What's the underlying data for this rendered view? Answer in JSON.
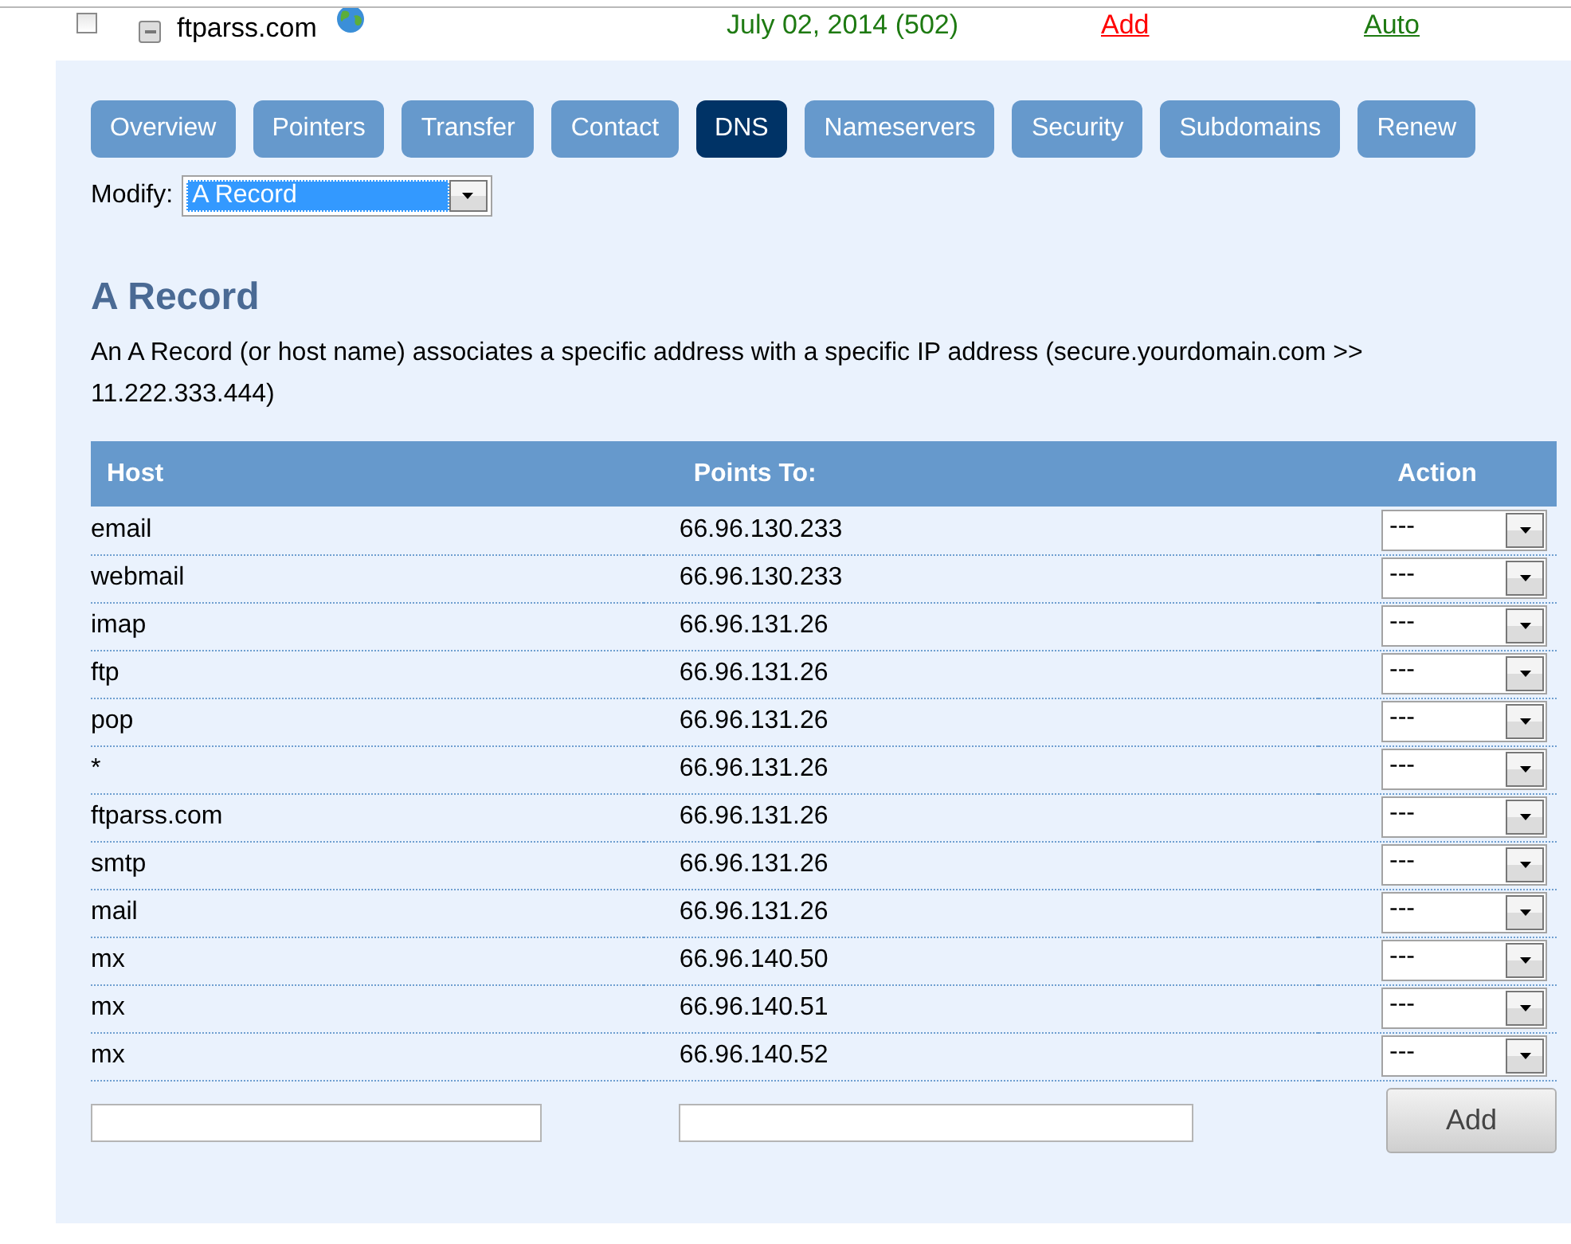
{
  "domain_row": {
    "checked": false,
    "domain": "ftparss.com",
    "expiry": "July 02, 2014 (502)",
    "add_link": "Add",
    "renew_link": "Auto"
  },
  "tabs": [
    {
      "label": "Overview",
      "selected": false
    },
    {
      "label": "Pointers",
      "selected": false
    },
    {
      "label": "Transfer",
      "selected": false
    },
    {
      "label": "Contact",
      "selected": false
    },
    {
      "label": "DNS",
      "selected": true
    },
    {
      "label": "Nameservers",
      "selected": false
    },
    {
      "label": "Security",
      "selected": false
    },
    {
      "label": "Subdomains",
      "selected": false
    },
    {
      "label": "Renew",
      "selected": false
    }
  ],
  "modify": {
    "label": "Modify:",
    "value": "A Record"
  },
  "section": {
    "title": "A Record",
    "description": "An A Record (or host name) associates a specific address with a specific IP address (secure.yourdomain.com >> 11.222.333.444)"
  },
  "table": {
    "columns": [
      "Host",
      "Points To:",
      "Action"
    ],
    "rows": [
      {
        "host": "email",
        "points_to": "66.96.130.233",
        "action": "---"
      },
      {
        "host": "webmail",
        "points_to": "66.96.130.233",
        "action": "---"
      },
      {
        "host": "imap",
        "points_to": "66.96.131.26",
        "action": "---"
      },
      {
        "host": "ftp",
        "points_to": "66.96.131.26",
        "action": "---"
      },
      {
        "host": "pop",
        "points_to": "66.96.131.26",
        "action": "---"
      },
      {
        "host": "*",
        "points_to": "66.96.131.26",
        "action": "---"
      },
      {
        "host": "ftparss.com",
        "points_to": "66.96.131.26",
        "action": "---"
      },
      {
        "host": "smtp",
        "points_to": "66.96.131.26",
        "action": "---"
      },
      {
        "host": "mail",
        "points_to": "66.96.131.26",
        "action": "---"
      },
      {
        "host": "mx",
        "points_to": "66.96.140.50",
        "action": "---"
      },
      {
        "host": "mx",
        "points_to": "66.96.140.51",
        "action": "---"
      },
      {
        "host": "mx",
        "points_to": "66.96.140.52",
        "action": "---"
      }
    ],
    "add_button": "Add"
  }
}
